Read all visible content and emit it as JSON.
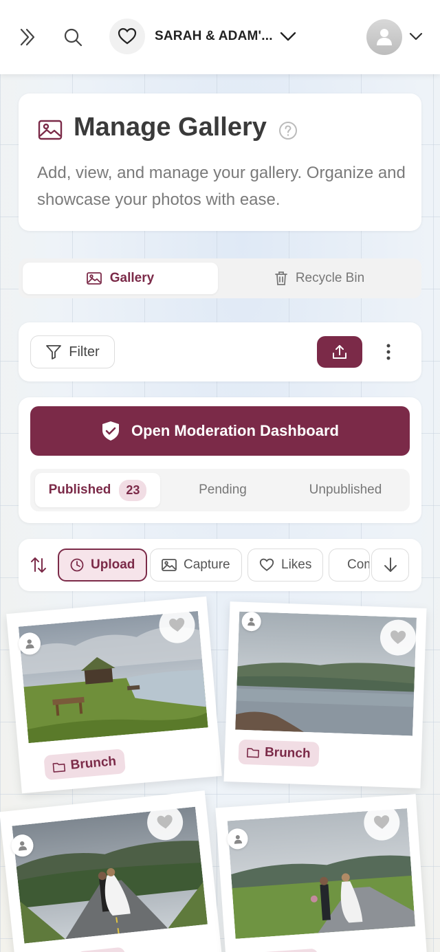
{
  "topbar": {
    "event_name": "SARAH & ADAM'...",
    "icons": [
      "expand-icon",
      "search-icon",
      "heart-icon",
      "chevron-down-icon",
      "avatar-icon",
      "chevron-down-icon"
    ]
  },
  "header": {
    "title": "Manage Gallery",
    "description": "Add, view, and manage your gallery. Organize and showcase your photos with ease."
  },
  "tabs": [
    {
      "label": "Gallery",
      "icon": "image-icon",
      "active": true
    },
    {
      "label": "Recycle Bin",
      "icon": "trash-icon",
      "active": false
    }
  ],
  "toolbar": {
    "filter_label": "Filter",
    "upload_icon": "upload-icon",
    "more_icon": "more-vertical-icon"
  },
  "moderation": {
    "button_label": "Open Moderation Dashboard",
    "status_tabs": [
      {
        "label": "Published",
        "count": "23",
        "active": true
      },
      {
        "label": "Pending"
      },
      {
        "label": "Unpublished"
      }
    ]
  },
  "sort": {
    "chips": [
      {
        "label": "Upload",
        "icon": "clock-icon",
        "active": true
      },
      {
        "label": "Capture",
        "icon": "image-icon"
      },
      {
        "label": "Likes",
        "icon": "heart-icon"
      },
      {
        "label": "Comments",
        "icon": "comment-icon"
      }
    ]
  },
  "photos": [
    {
      "tag": "Brunch"
    },
    {
      "tag": "Brunch"
    },
    {
      "tag": ""
    },
    {
      "tag": ""
    }
  ],
  "colors": {
    "accent": "#7b2a48",
    "accent_soft": "#f1dde4"
  }
}
